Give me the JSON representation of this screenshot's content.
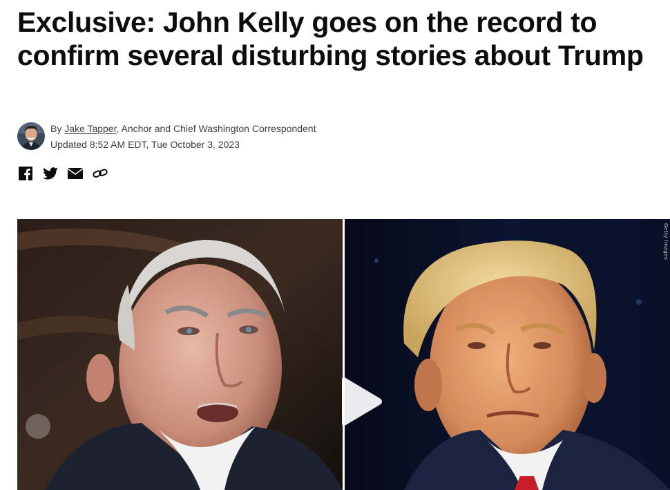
{
  "article": {
    "headline": "Exclusive: John Kelly goes on the record to confirm several disturbing stories about Trump"
  },
  "byline": {
    "prefix": "By ",
    "author": "Jake Tapper",
    "role": ", Anchor and Chief Washington Correspondent",
    "updated": "Updated 8:52 AM EDT, Tue October 3, 2023"
  },
  "share": {
    "icons": [
      "facebook-icon",
      "twitter-icon",
      "email-icon",
      "link-icon"
    ]
  },
  "media": {
    "credit": "Getty Images",
    "play_icon": "play-icon"
  },
  "colors": {
    "text": "#0c0c0c",
    "meta": "#404040",
    "play": "#ffffff"
  }
}
